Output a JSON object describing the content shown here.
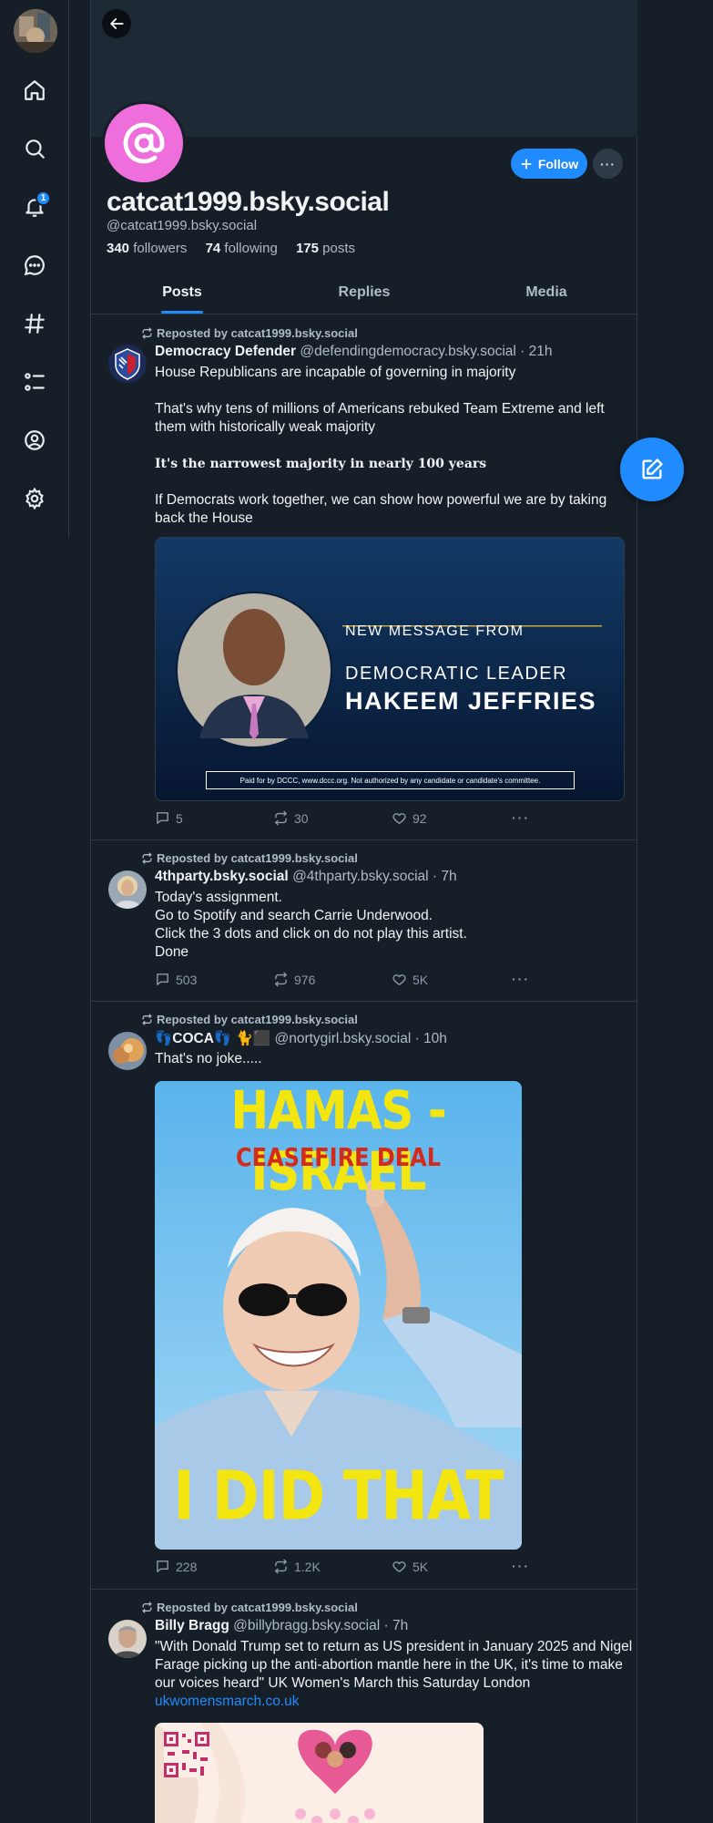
{
  "nav": {
    "items": [
      {
        "icon": "home-icon"
      },
      {
        "icon": "search-icon"
      },
      {
        "icon": "bell-icon",
        "badge": "1"
      },
      {
        "icon": "chat-icon"
      },
      {
        "icon": "hash-icon"
      },
      {
        "icon": "list-icon"
      },
      {
        "icon": "profile-icon"
      },
      {
        "icon": "gear-icon"
      }
    ]
  },
  "profile": {
    "display_name": "catcat1999.bsky.social",
    "handle": "@catcat1999.bsky.social",
    "followers_count": "340",
    "followers_label": "followers",
    "following_count": "74",
    "following_label": "following",
    "posts_count": "175",
    "posts_label": "posts",
    "follow_label": "Follow",
    "more_label": "···",
    "avatar_color": "#ee6fdc"
  },
  "tabs": [
    "Posts",
    "Replies",
    "Media"
  ],
  "posts": [
    {
      "repost": "Reposted by catcat1999.bsky.social",
      "name": "Democracy Defender",
      "meta": "@defendingdemocracy.bsky.social · 21h",
      "text": [
        "House Republicans are incapable of governing in majority",
        "",
        "That's why tens of millions of Americans rebuked Team Extreme and left them with historically weak majority",
        "",
        "𝐈𝐭'𝐬 𝐭𝐡𝐞 𝐧𝐚𝐫𝐫𝐨𝐰𝐞𝐬𝐭 𝐦𝐚𝐣𝐨𝐫𝐢𝐭𝐲 𝐢𝐧 𝐧𝐞𝐚𝐫𝐥𝐲 𝟏𝟎𝟎 𝐲𝐞𝐚𝐫𝐬",
        "",
        "If Democrats work together, we can show how powerful we are by taking back the House"
      ],
      "image": {
        "line1": "NEW MESSAGE FROM",
        "line2": "DEMOCRATIC LEADER",
        "line3": "HAKEEM JEFFRIES",
        "disclaimer": "Paid for by DCCC, www.dccc.org. Not authorized by any candidate or candidate's committee."
      },
      "replies": "5",
      "reposts": "30",
      "likes": "92"
    },
    {
      "repost": "Reposted by catcat1999.bsky.social",
      "name": "4thparty.bsky.social",
      "meta": "@4thparty.bsky.social · 7h",
      "text": [
        "Today's assignment.",
        "Go to Spotify and search Carrie Underwood.",
        "Click the 3 dots and click on do not play this artist.",
        "Done"
      ],
      "replies": "503",
      "reposts": "976",
      "likes": "5K"
    },
    {
      "repost": "Reposted by catcat1999.bsky.social",
      "name": "👣COCA👣 🐈⬛",
      "meta": "@nortygirl.bsky.social · 10h",
      "text": [
        "That's no joke....."
      ],
      "image": {
        "top": "HAMAS - ISRAEL",
        "sub": "CEASEFIRE DEAL",
        "bottom": "I DID THAT"
      },
      "replies": "228",
      "reposts": "1.2K",
      "likes": "5K"
    },
    {
      "repost": "Reposted by catcat1999.bsky.social",
      "name": "Billy Bragg",
      "meta": "@billybragg.bsky.social · 7h",
      "text": [
        "\"With Donald Trump set to return as US president in January 2025 and Nigel Farage picking up the anti-abortion mantle here in the UK, it's time to make our voices heard\" UK Women's March this Saturday London"
      ],
      "link": "ukwomensmarch.co.uk"
    }
  ],
  "colors": {
    "accent": "#208bfe",
    "background": "#161e27",
    "banner": "#1e2936"
  }
}
